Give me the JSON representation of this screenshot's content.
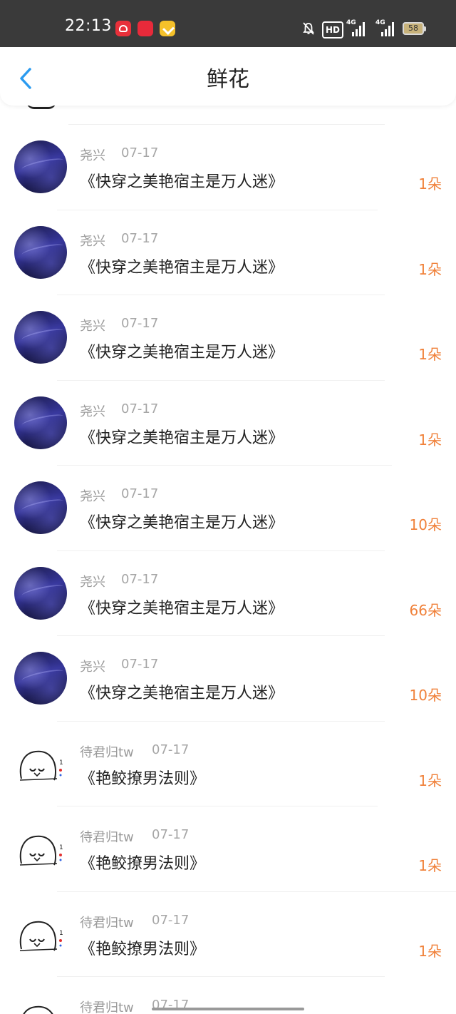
{
  "status_bar": {
    "time": "22:13",
    "app_icons": [
      "heart-app-icon",
      "xiaohongshu-app-icon",
      "checkmark-app-icon"
    ],
    "hd_label": "HD",
    "network_1": "4G",
    "network_2": "4G",
    "battery": "58"
  },
  "header": {
    "title": "鲜花",
    "back_icon": "chevron-left-icon"
  },
  "colors": {
    "accent_blue": "#2b9bf0",
    "count_orange": "#f0813a"
  },
  "gifts": [
    {
      "name": "尧兴",
      "date": "07-17",
      "book": "《快穿之美艳宿主是万人迷》",
      "count": "1朵"
    },
    {
      "name": "尧兴",
      "date": "07-17",
      "book": "《快穿之美艳宿主是万人迷》",
      "count": "1朵"
    },
    {
      "name": "尧兴",
      "date": "07-17",
      "book": "《快穿之美艳宿主是万人迷》",
      "count": "1朵"
    },
    {
      "name": "尧兴",
      "date": "07-17",
      "book": "《快穿之美艳宿主是万人迷》",
      "count": "1朵"
    },
    {
      "name": "尧兴",
      "date": "07-17",
      "book": "《快穿之美艳宿主是万人迷》",
      "count": "10朵"
    },
    {
      "name": "尧兴",
      "date": "07-17",
      "book": "《快穿之美艳宿主是万人迷》",
      "count": "66朵"
    },
    {
      "name": "尧兴",
      "date": "07-17",
      "book": "《快穿之美艳宿主是万人迷》",
      "count": "10朵"
    },
    {
      "name": "待君归tw",
      "date": "07-17",
      "book": "《艳鲛撩男法则》",
      "count": "1朵"
    },
    {
      "name": "待君归tw",
      "date": "07-17",
      "book": "《艳鲛撩男法则》",
      "count": "1朵"
    },
    {
      "name": "待君归tw",
      "date": "07-17",
      "book": "《艳鲛撩男法则》",
      "count": "1朵"
    },
    {
      "name": "待君归tw",
      "date": "07-17",
      "book": "",
      "count": ""
    }
  ]
}
